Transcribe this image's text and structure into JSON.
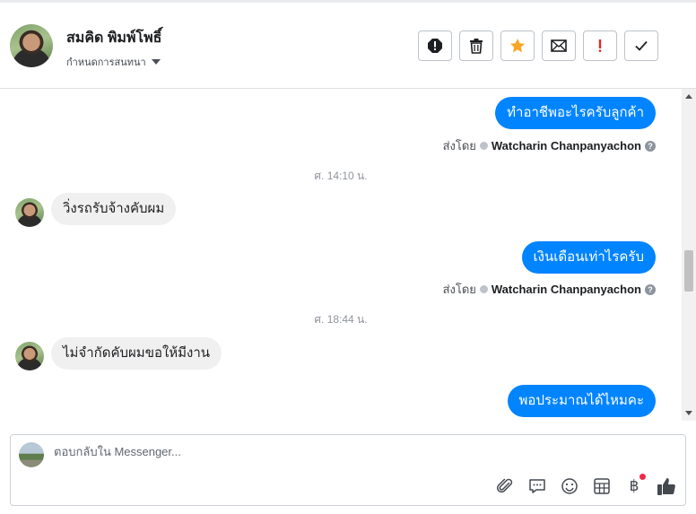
{
  "header": {
    "name": "สมคิด พิมพ์โพธิ์",
    "assign_label": "กำหนดการสนทนา",
    "actions": [
      {
        "icon": "alert-circle-icon"
      },
      {
        "icon": "trash-icon"
      },
      {
        "icon": "star-icon",
        "color": "#f5a623"
      },
      {
        "icon": "envelope-icon"
      },
      {
        "icon": "exclamation-icon",
        "color": "#e02b27"
      },
      {
        "icon": "check-icon"
      }
    ]
  },
  "conversation": {
    "messages": [
      {
        "text": "ทำอาชีพอะไรครับลูกค้า",
        "direction": "out"
      },
      {
        "text": "วิ่งรถรับจ้างคับผม",
        "direction": "in"
      },
      {
        "text": "เงินเดือนเท่าไรครับ",
        "direction": "out"
      },
      {
        "text": "ไม่จำกัดคับผมขอให้มีงาน",
        "direction": "in"
      },
      {
        "text": "พอประมาณได้ไหมคะ",
        "direction": "out"
      }
    ],
    "sent_by_label": "ส่งโดย",
    "sender": "Watcharin Chanpanyachon",
    "help_symbol": "?",
    "timestamps": [
      "ศ. 14:10 น.",
      "ศ. 18:44 น."
    ]
  },
  "composer": {
    "placeholder": "ตอบกลับใน Messenger...",
    "value": "",
    "tools": [
      "attachment-icon",
      "saved-reply-icon",
      "emoji-icon",
      "table-icon",
      "baht-icon",
      "like-icon"
    ],
    "baht_symbol": "฿",
    "accent": "#0084ff",
    "badge_color": "#f02849"
  }
}
